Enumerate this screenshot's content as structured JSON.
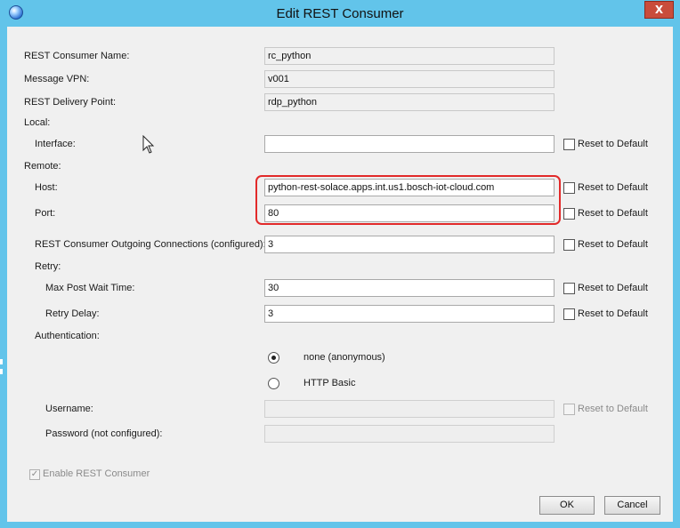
{
  "window": {
    "title": "Edit REST Consumer",
    "close_label": "X"
  },
  "fields": {
    "rest_consumer_name": {
      "label": "REST Consumer Name:",
      "value": "rc_python"
    },
    "message_vpn": {
      "label": "Message VPN:",
      "value": "v001"
    },
    "rest_delivery_point": {
      "label": "REST Delivery Point:",
      "value": "rdp_python"
    },
    "local_section": "Local:",
    "interface": {
      "label": "Interface:",
      "value": ""
    },
    "remote_section": "Remote:",
    "host": {
      "label": "Host:",
      "value": "python-rest-solace.apps.int.us1.bosch-iot-cloud.com"
    },
    "port": {
      "label": "Port:",
      "value": "80"
    },
    "outgoing_connections": {
      "label": "REST Consumer Outgoing Connections (configured):",
      "value": "3"
    },
    "retry_section": "Retry:",
    "max_post_wait_time": {
      "label": "Max Post Wait Time:",
      "value": "30"
    },
    "retry_delay": {
      "label": "Retry Delay:",
      "value": "3"
    },
    "authentication_section": "Authentication:",
    "username": {
      "label": "Username:",
      "value": ""
    },
    "password": {
      "label": "Password (not configured):",
      "value": ""
    }
  },
  "reset_label": "Reset to Default",
  "auth_options": [
    {
      "label": "none (anonymous)",
      "selected": true
    },
    {
      "label": "HTTP Basic",
      "selected": false
    }
  ],
  "enable_label": "Enable REST Consumer",
  "enable_checked": true,
  "buttons": {
    "ok": "OK",
    "cancel": "Cancel"
  },
  "colors": {
    "title_bar": "#62c4ea",
    "highlight": "#e22a2a",
    "close": "#c94c3b"
  }
}
